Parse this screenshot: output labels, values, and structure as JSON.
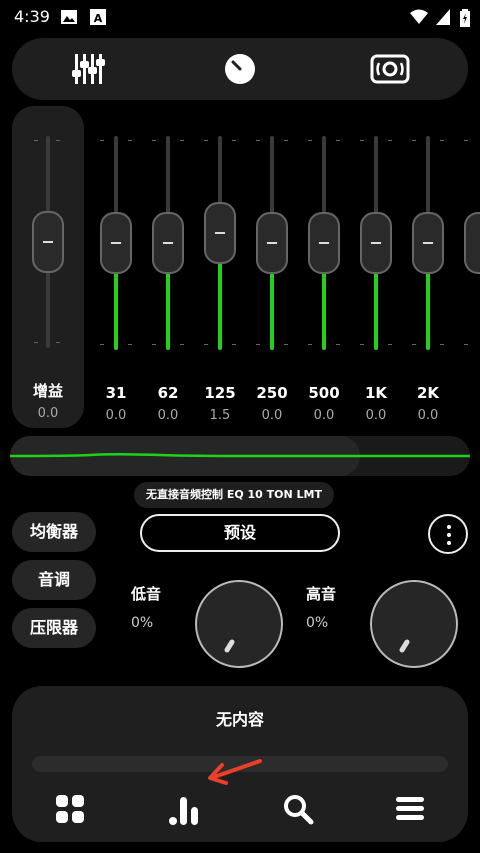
{
  "status_bar": {
    "time": "4:39"
  },
  "preamp": {
    "label": "增益",
    "value": "0.0"
  },
  "bands": [
    {
      "freq": "31",
      "gain": "0.0"
    },
    {
      "freq": "62",
      "gain": "0.0"
    },
    {
      "freq": "125",
      "gain": "1.5"
    },
    {
      "freq": "250",
      "gain": "0.0"
    },
    {
      "freq": "500",
      "gain": "0.0"
    },
    {
      "freq": "1K",
      "gain": "0.0"
    },
    {
      "freq": "2K",
      "gain": "0.0"
    }
  ],
  "chain_tag": "无直接音频控制 EQ 10 TON LMT",
  "side_tabs": {
    "equalizer": "均衡器",
    "tone": "音调",
    "limiter": "压限器"
  },
  "preset_button": "预设",
  "bass": {
    "label": "低音",
    "value": "0%"
  },
  "treble": {
    "label": "高音",
    "value": "0%"
  },
  "player": {
    "title": "无内容"
  },
  "nav_icons": [
    "grid-icon",
    "equalizer-bars-icon",
    "search-icon",
    "menu-icon"
  ],
  "top_tabs": [
    "sliders-icon",
    "knob-icon",
    "speaker-icon"
  ],
  "colors": {
    "accent": "#1ed31a",
    "background": "#000000",
    "panel": "#1f1f1f",
    "annotation_arrow": "#e8402a"
  }
}
